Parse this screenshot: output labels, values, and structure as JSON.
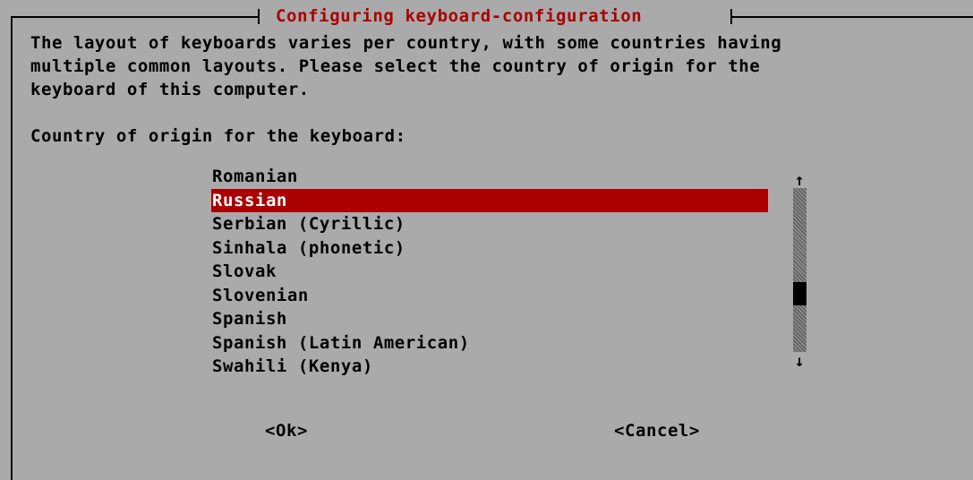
{
  "dialog": {
    "title": "Configuring keyboard-configuration",
    "description_lines": [
      "The layout of keyboards varies per country, with some countries having",
      "multiple common layouts. Please select the country of origin for the",
      "keyboard of this computer."
    ],
    "prompt": "Country of origin for the keyboard:"
  },
  "list": {
    "items": [
      "Romanian",
      "Russian",
      "Serbian (Cyrillic)",
      "Sinhala (phonetic)",
      "Slovak",
      "Slovenian",
      "Spanish",
      "Spanish (Latin American)",
      "Swahili (Kenya)"
    ],
    "selected": "Russian",
    "scroll_up_glyph": "↑",
    "scroll_down_glyph": "↓"
  },
  "buttons": {
    "ok": "<Ok>",
    "cancel": "<Cancel>"
  },
  "colors": {
    "background": "#aaaaaa",
    "title": "#aa0000",
    "selection_bg": "#aa0000",
    "selection_fg": "#ffffff",
    "text": "#000000"
  }
}
